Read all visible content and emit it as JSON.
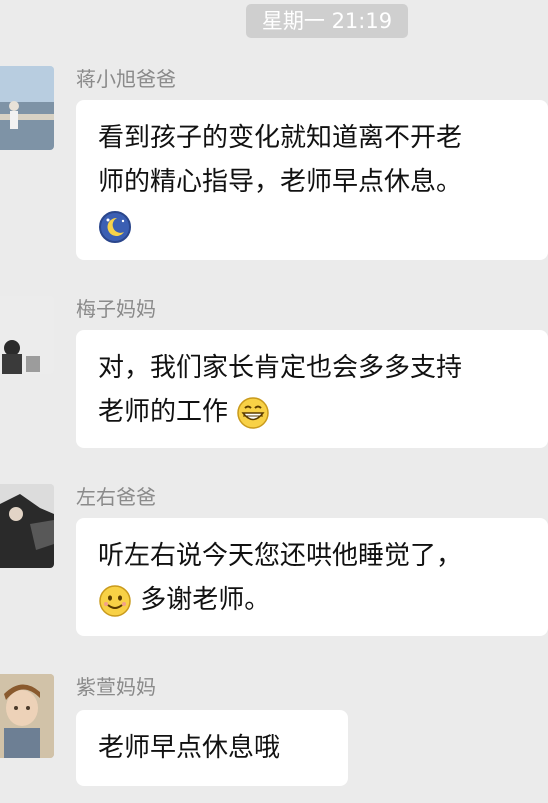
{
  "header": {
    "timestamp": "星期一 21:19"
  },
  "messages": [
    {
      "sender": "蒋小旭爸爸",
      "lines": [
        "看到孩子的变化就知道离不开老",
        "师的精心指导，老师早点休息。"
      ],
      "emoji": "moon-emoji"
    },
    {
      "sender": "梅子妈妈",
      "lines": [
        "对，我们家长肯定也会多多支持",
        "老师的工作"
      ],
      "emoji": "grin-emoji"
    },
    {
      "sender": "左右爸爸",
      "lines": [
        "听左右说今天您还哄他睡觉了，",
        "多谢老师。"
      ],
      "emoji": "smile-emoji"
    },
    {
      "sender": "紫萱妈妈",
      "lines": [
        "老师早点休息哦"
      ]
    }
  ],
  "colors": {
    "background": "#ebebeb",
    "bubble": "#ffffff",
    "timestamp_bg": "#cfcfcf",
    "sender_text": "#8a8a8a"
  }
}
